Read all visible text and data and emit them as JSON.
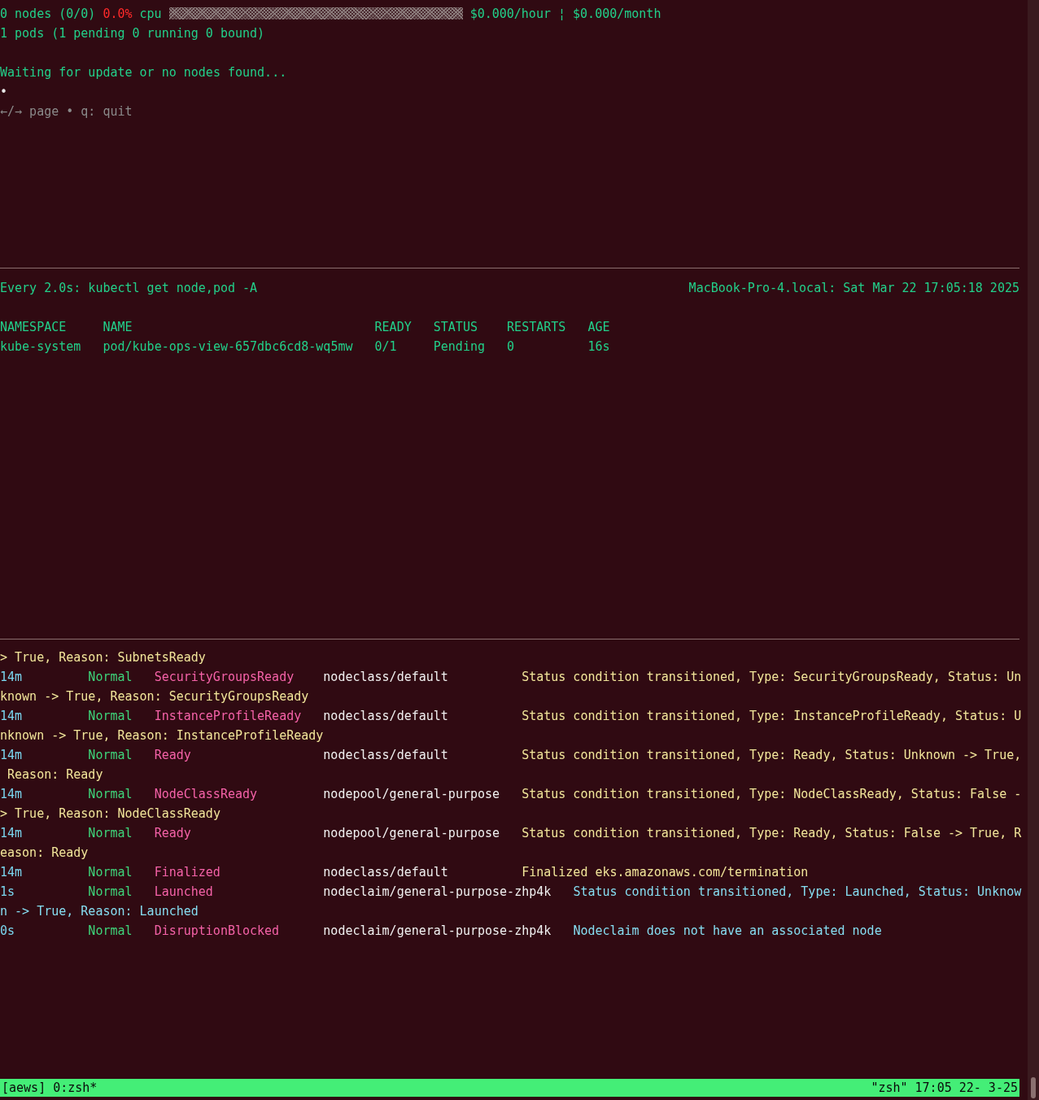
{
  "top_pane": {
    "summary": {
      "nodes": "0 nodes (0/0)",
      "cpu_percent": "0.0%",
      "cpu_label": "cpu",
      "cpu_meter": {
        "level": 0
      },
      "cost": "$0.000/hour ¦ $0.000/month"
    },
    "pods_line": "1 pods (1 pending 0 running 0 bound)",
    "message": "Waiting for update or no nodes found...",
    "spinner": "•",
    "help": "←/→ page • q: quit"
  },
  "watch_pane": {
    "command": "Every 2.0s: kubectl get node,pod -A",
    "host_time": "MacBook-Pro-4.local: Sat Mar 22 17:05:18 2025",
    "table": {
      "columns": [
        "NAMESPACE",
        "NAME",
        "READY",
        "STATUS",
        "RESTARTS",
        "AGE"
      ],
      "rows": [
        [
          "kube-system",
          "pod/kube-ops-view-657dbc6cd8-wq5mw",
          "0/1",
          "Pending",
          "0",
          "16s"
        ]
      ]
    }
  },
  "events_pane": {
    "leading_fragment": "> True, Reason: SubnetsReady",
    "events": [
      {
        "age": "14m",
        "type": "Normal",
        "reason": "SecurityGroupsReady",
        "object": "nodeclass/default",
        "message": "Status condition transitioned, Type: SecurityGroupsReady, Status: Un",
        "message_continued": "known -> True, Reason: SecurityGroupsReady",
        "color": "#f2e69a"
      },
      {
        "age": "14m",
        "type": "Normal",
        "reason": "InstanceProfileReady",
        "object": "nodeclass/default",
        "message": "Status condition transitioned, Type: InstanceProfileReady, Status: U",
        "message_continued": "nknown -> True, Reason: InstanceProfileReady",
        "color": "#f2e69a"
      },
      {
        "age": "14m",
        "type": "Normal",
        "reason": "Ready",
        "object": "nodeclass/default",
        "message": "Status condition transitioned, Type: Ready, Status: Unknown -> True,",
        "message_continued": " Reason: Ready",
        "color": "#f2e69a"
      },
      {
        "age": "14m",
        "type": "Normal",
        "reason": "NodeClassReady",
        "object": "nodepool/general-purpose",
        "message": "Status condition transitioned, Type: NodeClassReady, Status: False -",
        "message_continued": "> True, Reason: NodeClassReady",
        "color": "#f2e69a"
      },
      {
        "age": "14m",
        "type": "Normal",
        "reason": "Ready",
        "object": "nodepool/general-purpose",
        "message": "Status condition transitioned, Type: Ready, Status: False -> True, R",
        "message_continued": "eason: Ready",
        "color": "#f2e69a"
      },
      {
        "age": "14m",
        "type": "Normal",
        "reason": "Finalized",
        "object": "nodeclass/default",
        "message": "Finalized eks.amazonaws.com/termination",
        "color": "#f2e69a"
      },
      {
        "age": "1s",
        "type": "Normal",
        "reason": "Launched",
        "object": "nodeclaim/general-purpose-zhp4k",
        "message": "Status condition transitioned, Type: Launched, Status: Unknow",
        "message_continued": "n -> True, Reason: Launched",
        "color": "#86def2"
      },
      {
        "age": "0s",
        "type": "Normal",
        "reason": "DisruptionBlocked",
        "object": "nodeclaim/general-purpose-zhp4k",
        "message": "Nodeclaim does not have an associated node",
        "color": "#86def2"
      }
    ]
  },
  "status_bar": {
    "session": "[aews] 0:zsh*",
    "right": "\"zsh\" 17:05 22- 3-25"
  }
}
